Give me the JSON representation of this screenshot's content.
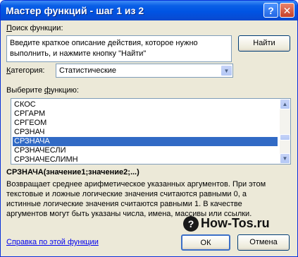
{
  "window": {
    "title": "Мастер функций - шаг 1 из 2",
    "help_symbol": "?",
    "close_symbol": "✕"
  },
  "search": {
    "label_pre": "",
    "label_key": "П",
    "label_post": "оиск функции:",
    "value_line1": "Введите краткое описание действия, которое нужно",
    "value_line2": "выполнить, и нажмите кнопку \"Найти\"",
    "find_button": "Найти"
  },
  "category": {
    "label_key": "К",
    "label_post": "атегория:",
    "selected": "Статистические",
    "arrow": "▼"
  },
  "function_list": {
    "label_pre": "Выберите ",
    "label_key": "ф",
    "label_post": "ункцию:",
    "items": [
      "СКОС",
      "СРГАРМ",
      "СРГЕОМ",
      "СРЗНАЧ",
      "СРЗНАЧА",
      "СРЗНАЧЕСЛИ",
      "СРЗНАЧЕСЛИМН"
    ],
    "selected_index": 4,
    "scroll_up": "▲",
    "scroll_down": "▼"
  },
  "signature": "СРЗНАЧА(значение1;значение2;...)",
  "description": {
    "line1": "Возвращает среднее арифметическое указанных аргументов. При этом",
    "line2": "текстовые и ложные логические значения считаются равными 0, а",
    "line3": "истинные логические значения считаются равными 1. В качестве",
    "line4": "аргументов могут быть указаны числа, имена, массивы или ссылки."
  },
  "watermark": {
    "symbol": "?",
    "text": "How-Tos.ru"
  },
  "footer": {
    "help_link": "Справка по этой функции",
    "ok": "ОК",
    "cancel": "Отмена"
  },
  "colors": {
    "titlebar": "#0054e3",
    "selection": "#316ac5",
    "link": "#0000ee",
    "dialog": "#ece9d8"
  }
}
